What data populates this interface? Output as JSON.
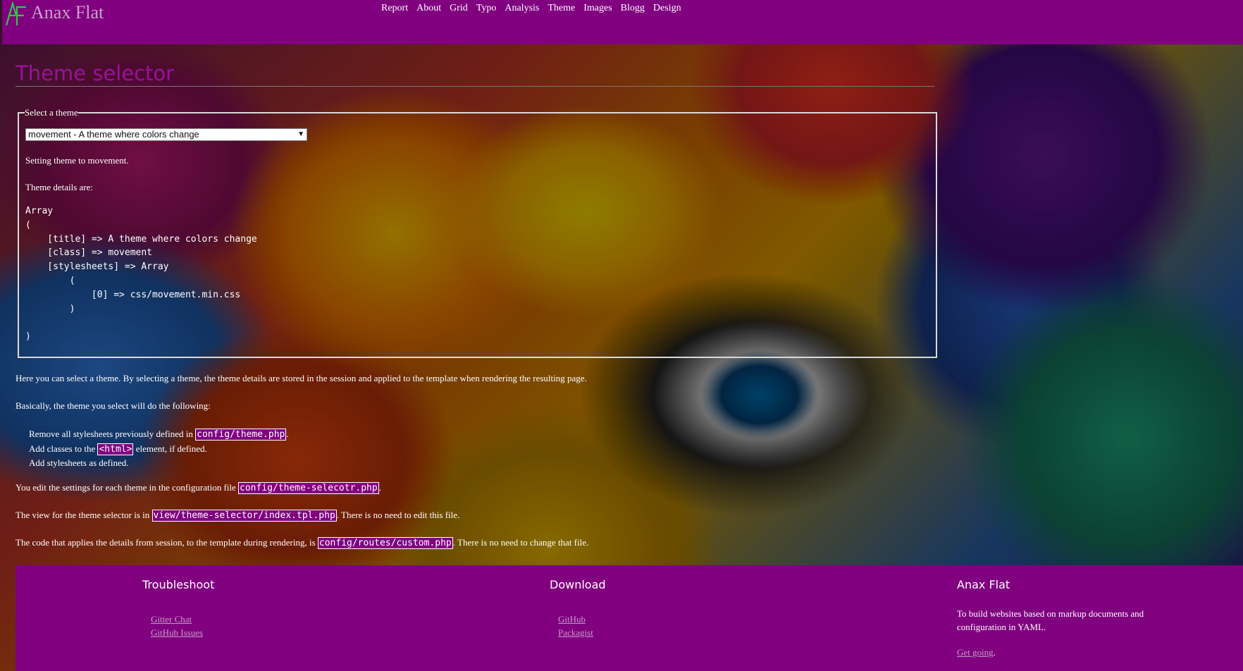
{
  "header": {
    "site_title": "Anax Flat",
    "logo_text": "AF",
    "nav": [
      "Report",
      "About",
      "Grid",
      "Typo",
      "Analysis",
      "Theme",
      "Images",
      "Blogg",
      "Design"
    ],
    "menu_icon": "⋮"
  },
  "main": {
    "title": "Theme selector",
    "fieldset_legend": "Select a theme",
    "select_value": "movement - A theme where colors change",
    "message_setting": "Setting theme to movement.",
    "message_details": "Theme details are:",
    "details_pre": "Array\n(\n    [title] => A theme where colors change\n    [class] => movement\n    [stylesheets] => Array\n        (\n            [0] => css/movement.min.css\n        )\n\n)",
    "intro": "Here you can select a theme. By selecting a theme, the theme details are stored in the session and applied to the template when rendering the resulting page.",
    "basically": "Basically, the theme you select will do the following:",
    "list": {
      "item1_pre": "Remove all stylesheets previously defined in ",
      "item1_code": "config/theme.php",
      "item1_post": ".",
      "item2_pre": "Add classes to the ",
      "item2_code": "<html>",
      "item2_post": " element, if defined.",
      "item3": "Add stylesheets as defined."
    },
    "edit_pre": "You edit the settings for each theme in the configuration file ",
    "edit_code": "config/theme-selecotr.php",
    "edit_post": ".",
    "view_pre": "The view for the theme selector is in ",
    "view_code": "view/theme-selector/index.tpl.php",
    "view_post": ". There is no need to edit this file.",
    "code_pre": "The code that applies the details from session, to the template during rendering, is ",
    "code_code": "config/routes/custom.php",
    "code_post": ". There is no need to change that file."
  },
  "footer": {
    "troubleshoot": {
      "title": "Troubleshoot",
      "links": [
        "Gitter Chat",
        "GitHub Issues"
      ]
    },
    "download": {
      "title": "Download",
      "links": [
        "GitHub",
        "Packagist"
      ]
    },
    "about": {
      "title": "Anax Flat",
      "text": "To build websites based on markup documents and configuration in YAML.",
      "link": "Get going",
      "link_post": "."
    }
  },
  "colors": {
    "header_bg": "#800080",
    "title": "#9b119b",
    "footer_link": "#c79ac7"
  }
}
